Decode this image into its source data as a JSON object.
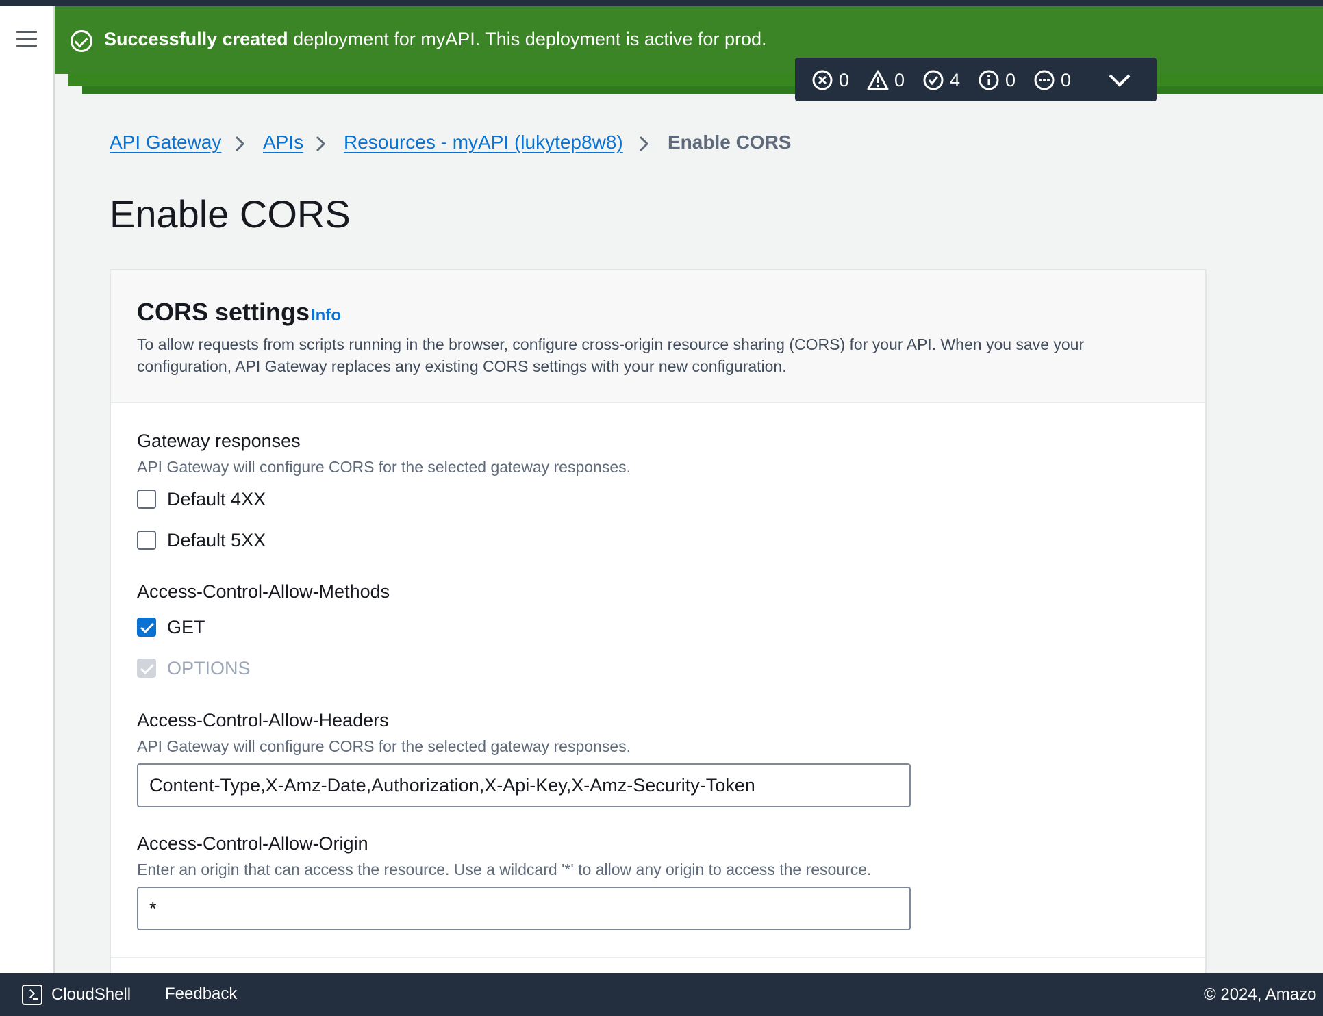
{
  "flash": {
    "bold": "Successfully created",
    "message": "deployment for myAPI. This deployment is active for prod."
  },
  "counters": [
    {
      "icon": "error-icon",
      "count": "0"
    },
    {
      "icon": "warning-icon",
      "count": "0"
    },
    {
      "icon": "success-icon",
      "count": "4"
    },
    {
      "icon": "info-icon",
      "count": "0"
    },
    {
      "icon": "in-progress-icon",
      "count": "0"
    }
  ],
  "breadcrumb": {
    "items": [
      "API Gateway",
      "APIs",
      "Resources - myAPI (lukytep8w8)"
    ],
    "current": "Enable CORS"
  },
  "page": {
    "title": "Enable CORS"
  },
  "panel": {
    "title": "CORS settings",
    "info": "Info",
    "description": "To allow requests from scripts running in the browser, configure cross-origin resource sharing (CORS) for your API. When you save your configuration, API Gateway replaces any existing CORS settings with your new configuration."
  },
  "gateway_responses": {
    "label": "Gateway responses",
    "description": "API Gateway will configure CORS for the selected gateway responses.",
    "options": [
      {
        "label": "Default 4XX",
        "checked": false
      },
      {
        "label": "Default 5XX",
        "checked": false
      }
    ]
  },
  "methods": {
    "label": "Access-Control-Allow-Methods",
    "options": [
      {
        "label": "GET",
        "checked": true,
        "disabled": false
      },
      {
        "label": "OPTIONS",
        "checked": true,
        "disabled": true
      }
    ]
  },
  "headers": {
    "label": "Access-Control-Allow-Headers",
    "description": "API Gateway will configure CORS for the selected gateway responses.",
    "value": "Content-Type,X-Amz-Date,Authorization,X-Api-Key,X-Amz-Security-Token"
  },
  "origin": {
    "label": "Access-Control-Allow-Origin",
    "description": "Enter an origin that can access the resource. Use a wildcard '*' to allow any origin to access the resource.",
    "value": "*"
  },
  "footer": {
    "cloudshell": "CloudShell",
    "feedback": "Feedback",
    "copyright": "© 2024, Amazo"
  },
  "colors": {
    "flash_success": "#3c8527",
    "link": "#0972d3",
    "dark_bar": "#232f3e",
    "page_bg": "#f2f3f3"
  }
}
